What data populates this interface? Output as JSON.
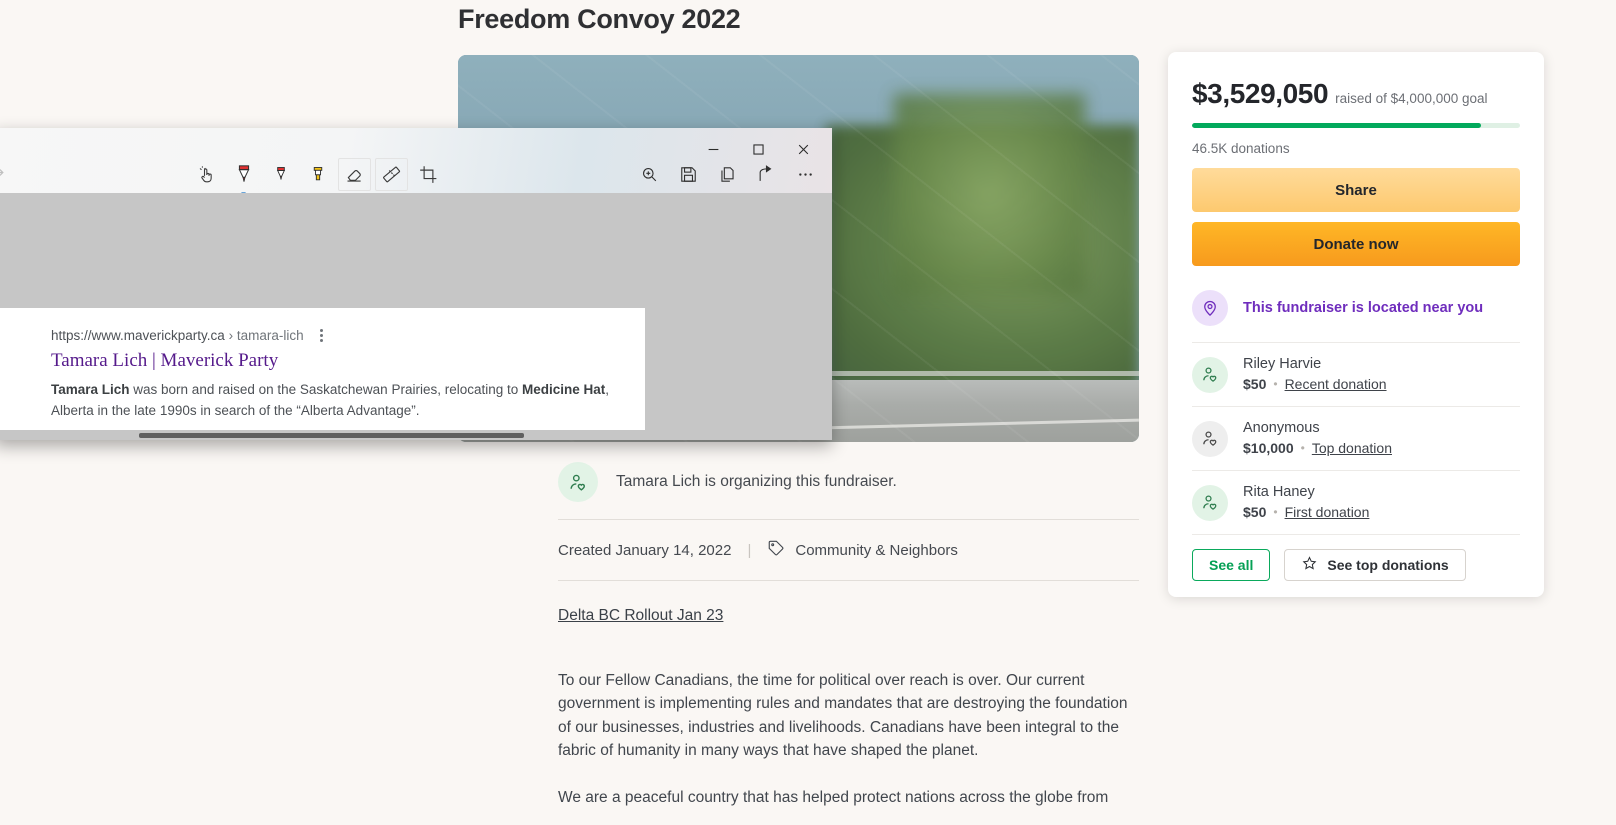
{
  "fundraiser": {
    "title": "Freedom Convoy 2022",
    "hero_alt": "red-semi-truck-on-highway",
    "organizer_text": "Tamara Lich is organizing this fundraiser.",
    "created": "Created January 14, 2022",
    "separator": "|",
    "category": "Community & Neighbors",
    "story_link": "Delta BC Rollout Jan 23",
    "paragraph_1": "To our Fellow Canadians, the time for political over reach is over.  Our current government is implementing rules and mandates that are destroying the foundation of our businesses, industries and livelihoods.  Canadians have been integral to the fabric of humanity in many ways that have shaped the planet.",
    "paragraph_2": "We are a peaceful country that has helped protect nations across the globe from"
  },
  "donation_card": {
    "raised_amount": "$3,529,050",
    "goal_text": "raised of $4,000,000 goal",
    "progress_percent": 88,
    "donations_count": "46.5K donations",
    "share_label": "Share",
    "donate_label": "Donate now",
    "near_you_text": "This fundraiser is located near you",
    "donors": [
      {
        "name": "Riley Harvie",
        "amount": "$50",
        "dot": "•",
        "tag": "Recent donation",
        "avatar": "person-heart-icon",
        "avatar_style": "green"
      },
      {
        "name": "Anonymous",
        "amount": "$10,000",
        "dot": "•",
        "tag": "Top donation",
        "avatar": "person-heart-icon",
        "avatar_style": "grey"
      },
      {
        "name": "Rita Haney",
        "amount": "$50",
        "dot": "•",
        "tag": "First donation",
        "avatar": "person-heart-icon",
        "avatar_style": "green"
      }
    ],
    "see_all_label": "See all",
    "see_top_label": "See top donations",
    "colors": {
      "progress": "#02a95c",
      "donate": "#f79a1d",
      "near_you": "#6f2dbd",
      "see_all": "#05a055"
    }
  },
  "snipping_tool": {
    "window_controls": [
      {
        "name": "minimize-button",
        "glyph": "–"
      },
      {
        "name": "maximize-button",
        "glyph": "□"
      },
      {
        "name": "close-button",
        "glyph": "✕"
      }
    ],
    "tools": [
      {
        "name": "touch-writing-icon",
        "label": "Touch writing"
      },
      {
        "name": "ballpoint-pen-icon",
        "label": "Ballpoint pen",
        "selected": true
      },
      {
        "name": "pencil-icon",
        "label": "Pencil"
      },
      {
        "name": "highlighter-icon",
        "label": "Highlighter"
      },
      {
        "name": "eraser-icon",
        "label": "Eraser"
      },
      {
        "name": "ruler-icon",
        "label": "Ruler"
      },
      {
        "name": "crop-icon",
        "label": "Crop"
      }
    ],
    "right_tools": [
      {
        "name": "zoom-icon",
        "label": "Zoom"
      },
      {
        "name": "save-icon",
        "label": "Save"
      },
      {
        "name": "copy-icon",
        "label": "Copy"
      },
      {
        "name": "share-icon",
        "label": "Share"
      },
      {
        "name": "more-options-icon",
        "label": "See more"
      }
    ],
    "snippet": {
      "url": "https://www.maverickparty.ca",
      "crumb": "› tamara-lich",
      "title": "Tamara Lich | Maverick Party",
      "snippet_bold_1": "Tamara Lich",
      "snippet_mid": " was born and raised on the Saskatchewan Prairies, relocating to ",
      "snippet_bold_2": "Medicine Hat",
      "snippet_end": ", Alberta in the late 1990s in search of the “Alberta Advantage”."
    }
  }
}
